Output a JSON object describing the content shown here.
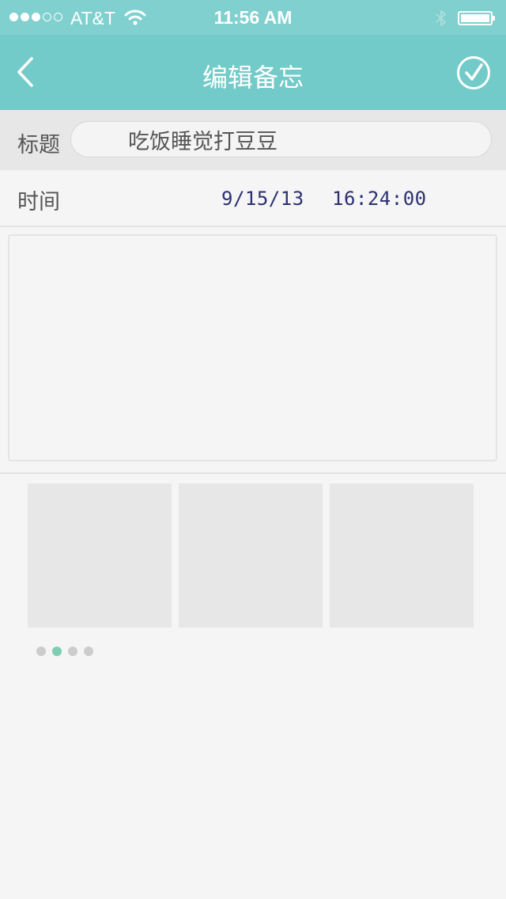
{
  "status_bar": {
    "carrier": "AT&T",
    "time": "11:56 AM",
    "signal_strength": 3,
    "signal_max": 5,
    "icons": [
      "wifi-icon",
      "bluetooth-icon",
      "battery-icon"
    ]
  },
  "nav_bar": {
    "title": "编辑备忘",
    "back_icon": "chevron-left-icon",
    "confirm_icon": "check-circle-icon"
  },
  "form": {
    "title_label": "标题",
    "title_value": "吃饭睡觉打豆豆",
    "time_label": "时间",
    "date_value": "9/15/13",
    "time_value": "16:24:00",
    "content_value": ""
  },
  "gallery": {
    "slot_count": 3,
    "page_count": 4,
    "active_page": 1
  },
  "colors": {
    "status_bar": "#7fd0cf",
    "nav_bar": "#72cbc8",
    "accent_dot": "#7ecdb4",
    "time_text": "#2b3170",
    "background": "#f5f5f5"
  }
}
